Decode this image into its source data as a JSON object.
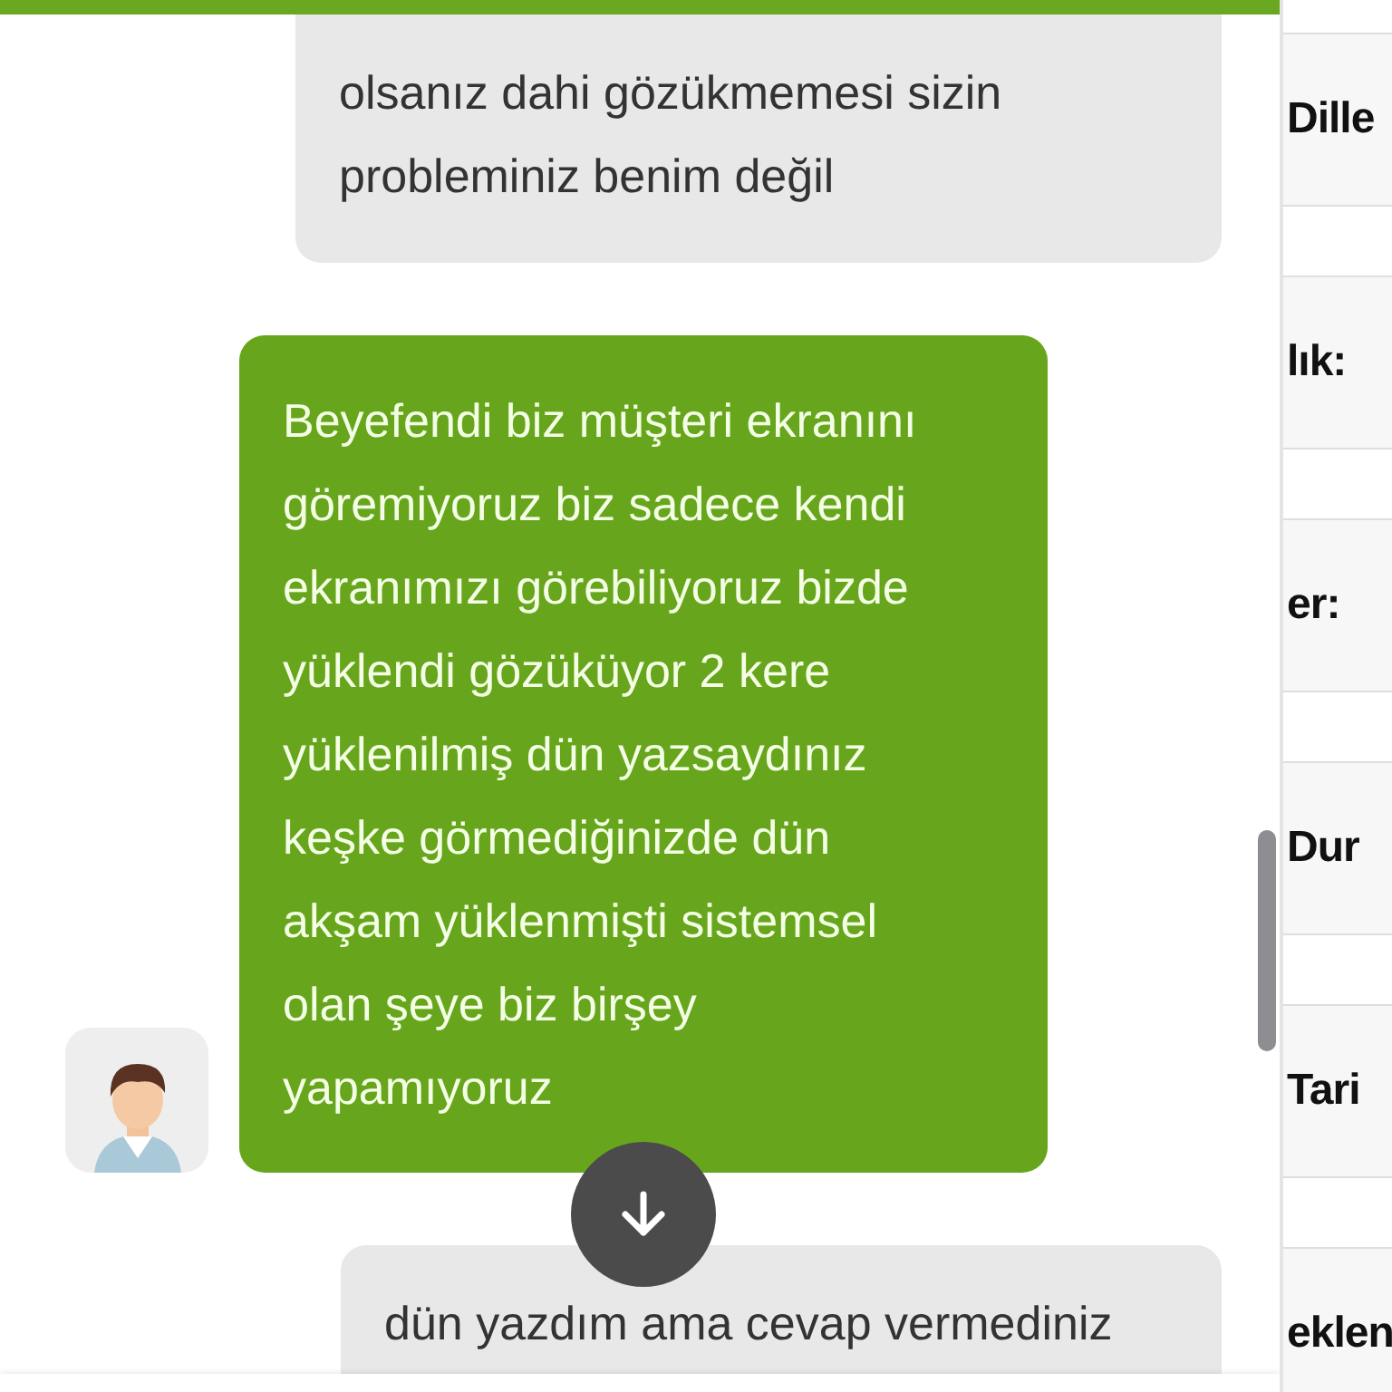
{
  "messages": [
    {
      "kind": "customer",
      "text": "olsanız dahi gözükmemesi sizin probleminiz benim değil"
    },
    {
      "kind": "agent",
      "text": "Beyefendi biz müşteri ekranını göremiyoruz biz sadece kendi ekranımızı görebiliyoruz bizde yüklendi gözüküyor 2 kere yüklenilmiş dün yazsaydınız keşke görmediğinizde dün akşam yüklenmişti sistemsel olan şeye biz birşey yapamıyoruz"
    },
    {
      "kind": "customer",
      "text": "dün yazdım ama cevap vermediniz"
    }
  ],
  "side_panel": {
    "labels": [
      "Dille",
      "lık:",
      "er:",
      "Dur",
      "Tari",
      "eklen"
    ]
  }
}
